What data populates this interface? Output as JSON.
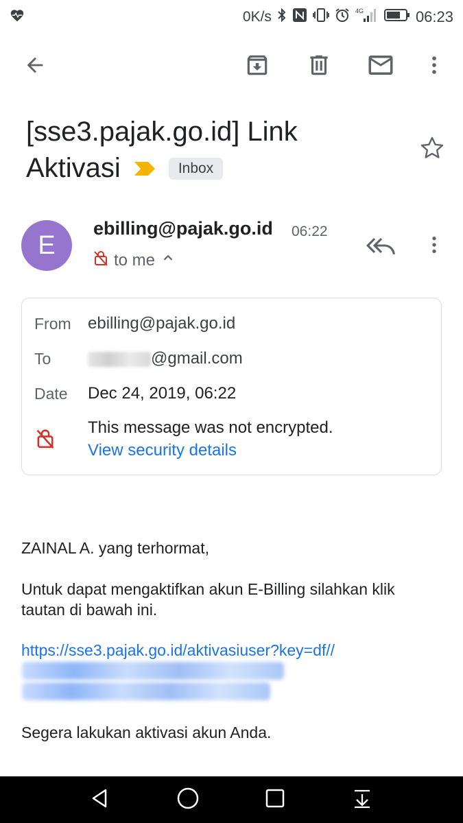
{
  "status_bar": {
    "speed": "0K/s",
    "time": "06:23",
    "icons": [
      "heart-pulse-icon",
      "bluetooth-icon",
      "nfc-icon",
      "vibrate-icon",
      "alarm-icon",
      "signal-4g-icon",
      "battery-icon"
    ]
  },
  "toolbar": {
    "icons": [
      "back-arrow-icon",
      "archive-icon",
      "delete-icon",
      "mark-unread-icon",
      "more-vert-icon"
    ]
  },
  "email": {
    "subject_line1": "[sse3.pajak.go.id] Link",
    "subject_line2": "Aktivasi",
    "label": "Inbox",
    "sender": "ebilling@pajak.go.id",
    "time": "06:22",
    "to_me": "to me",
    "avatar_letter": "E",
    "avatar_color": "#9575cd"
  },
  "details": {
    "from_label": "From",
    "from_value": "ebilling@pajak.go.id",
    "to_label": "To",
    "to_value": "@gmail.com",
    "date_label": "Date",
    "date_value": "Dec 24, 2019, 06:22",
    "encryption_text": "This message was not encrypted.",
    "security_link": "View security details"
  },
  "body": {
    "greeting": "ZAINAL A. yang terhormat,",
    "paragraph_line1": "Untuk dapat mengaktifkan akun E-Billing silahkan klik",
    "paragraph_line2": "tautan di bawah ini.",
    "link_line1": "https://sse3.pajak.go.id/aktivasiuser?key=df//",
    "closing": "Segera lakukan aktivasi akun Anda."
  },
  "nav_bar": {
    "icons": [
      "nav-back-icon",
      "nav-home-icon",
      "nav-recent-icon",
      "nav-notification-icon"
    ]
  },
  "colors": {
    "link": "#1a73e8",
    "importance": "#f4b400",
    "warning_red": "#d93025"
  }
}
